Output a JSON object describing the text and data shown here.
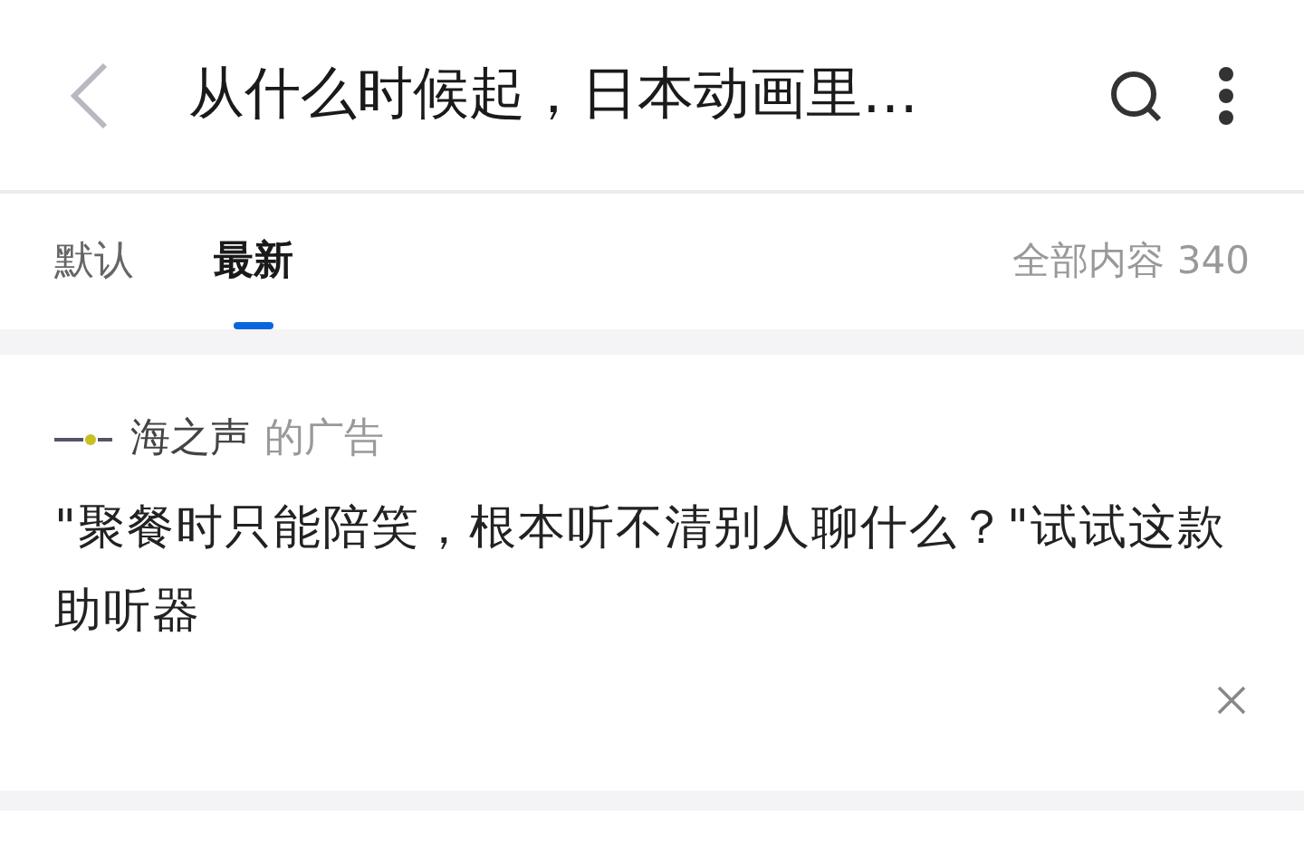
{
  "header": {
    "title": "从什么时候起，日本动画里…"
  },
  "tabs": [
    {
      "label": "默认",
      "selected": false
    },
    {
      "label": "最新",
      "selected": true
    }
  ],
  "total": "全部内容 340",
  "ad": {
    "advertiser": "海之声",
    "suffix": "的广告",
    "text": "\"聚餐时只能陪笑，根本听不清别人聊什么？\"试试这款助听器"
  }
}
